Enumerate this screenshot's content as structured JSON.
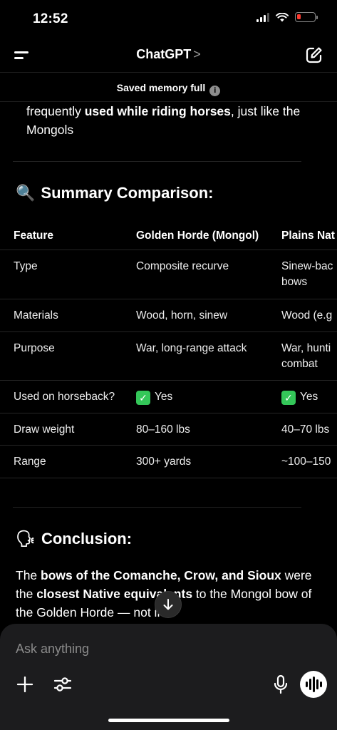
{
  "status_bar": {
    "time": "12:52"
  },
  "nav": {
    "title": "ChatGPT",
    "chevron": ">"
  },
  "memory_banner": {
    "text": "Saved memory full",
    "info": "i"
  },
  "partial_text": {
    "prefix": "frequently ",
    "bold": "used while riding horses",
    "suffix": ", just like the Mongols"
  },
  "summary": {
    "emoji": "🔍",
    "heading": "Summary Comparison:",
    "columns": [
      "Feature",
      "Golden Horde (Mongol)",
      "Plains Nat"
    ],
    "rows": [
      {
        "feature": "Type",
        "mongol": "Composite recurve",
        "plains": "Sinew-bac bows"
      },
      {
        "feature": "Materials",
        "mongol": "Wood, horn, sinew",
        "plains": "Wood (e.g"
      },
      {
        "feature": "Purpose",
        "mongol": "War, long-range attack",
        "plains": "War, hunti combat"
      },
      {
        "feature": "Used on horseback?",
        "mongol": "Yes",
        "plains": "Yes",
        "check": "✓"
      },
      {
        "feature": "Draw weight",
        "mongol": "80–160 lbs",
        "plains": "40–70 lbs"
      },
      {
        "feature": "Range",
        "mongol": "300+ yards",
        "plains": "~100–150"
      }
    ]
  },
  "conclusion": {
    "emoji": "🗣",
    "heading": "Conclusion:",
    "t1": "The ",
    "b1": "bows of the Comanche, Crow, and Sioux",
    "t2": " were the ",
    "b2": "closest Native equivalents",
    "t3": " to the Mongol bow of the Golden Horde — not in"
  },
  "composer": {
    "placeholder": "Ask anything"
  },
  "colors": {
    "background": "#000000",
    "composer": "#1c1c1e",
    "check": "#34c759",
    "battery_low": "#ff3b30"
  },
  "icons": [
    "menu-icon",
    "chevron-right-icon",
    "edit-icon",
    "info-icon",
    "arrow-down-icon",
    "plus-icon",
    "sliders-icon",
    "microphone-icon",
    "voice-waveform-icon",
    "wifi-icon",
    "signal-icon",
    "battery-icon"
  ]
}
